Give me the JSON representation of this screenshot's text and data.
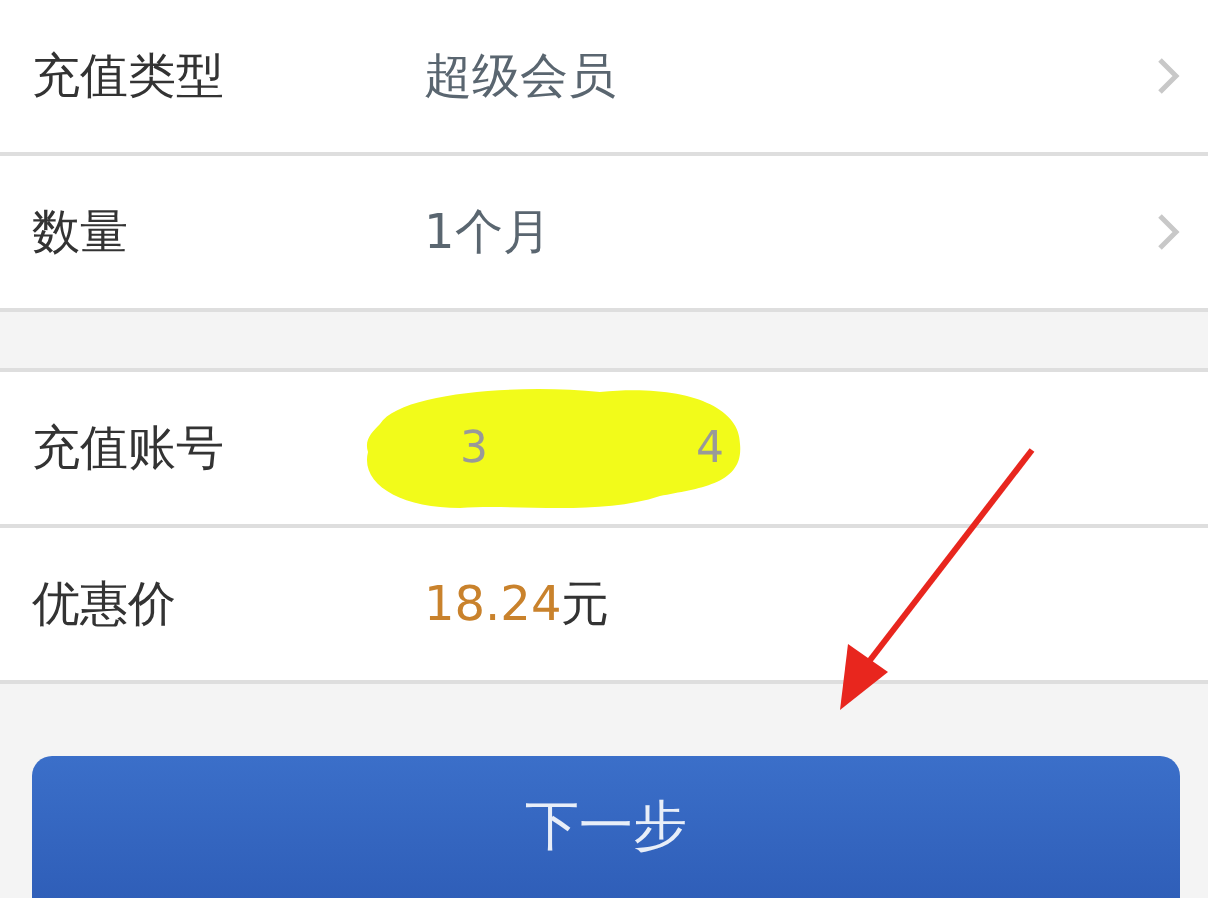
{
  "groups": [
    {
      "rows": [
        {
          "kind": "select",
          "label": "充值类型",
          "value": "超级会员"
        },
        {
          "kind": "select",
          "label": "数量",
          "value": "1个月"
        }
      ]
    },
    {
      "rows": [
        {
          "kind": "account",
          "label": "充值账号",
          "value_start": "3",
          "value_end": "4"
        },
        {
          "kind": "price",
          "label": "优惠价",
          "amount": "18.24",
          "unit": "元"
        }
      ]
    }
  ],
  "button": {
    "label": "下一步"
  }
}
